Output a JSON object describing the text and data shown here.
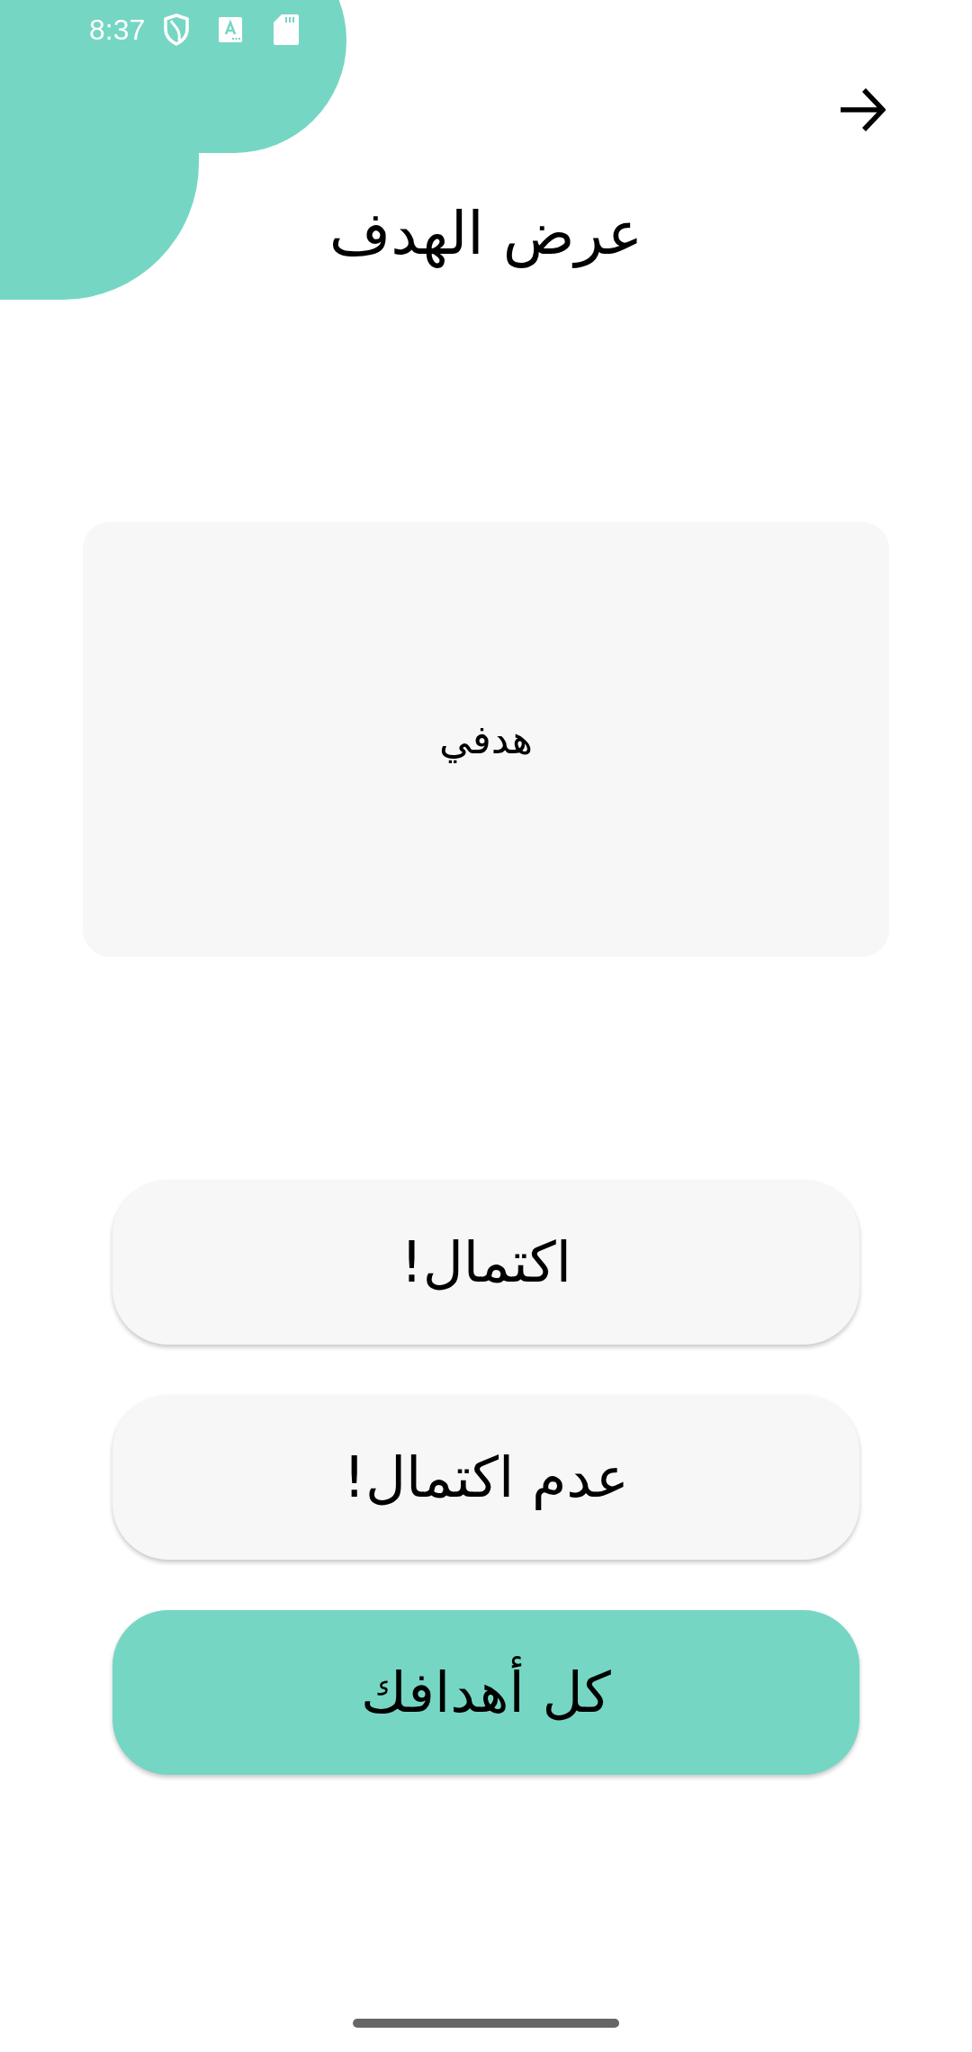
{
  "status_bar": {
    "time": "8:37"
  },
  "header": {
    "title": "عرض الهدف"
  },
  "goal_card": {
    "text": "هدفي"
  },
  "buttons": [
    {
      "label": "اكتمال!",
      "kind": "secondary"
    },
    {
      "label": "عدم اكتمال!",
      "kind": "secondary"
    },
    {
      "label": "كل أهدافك",
      "kind": "primary"
    }
  ]
}
